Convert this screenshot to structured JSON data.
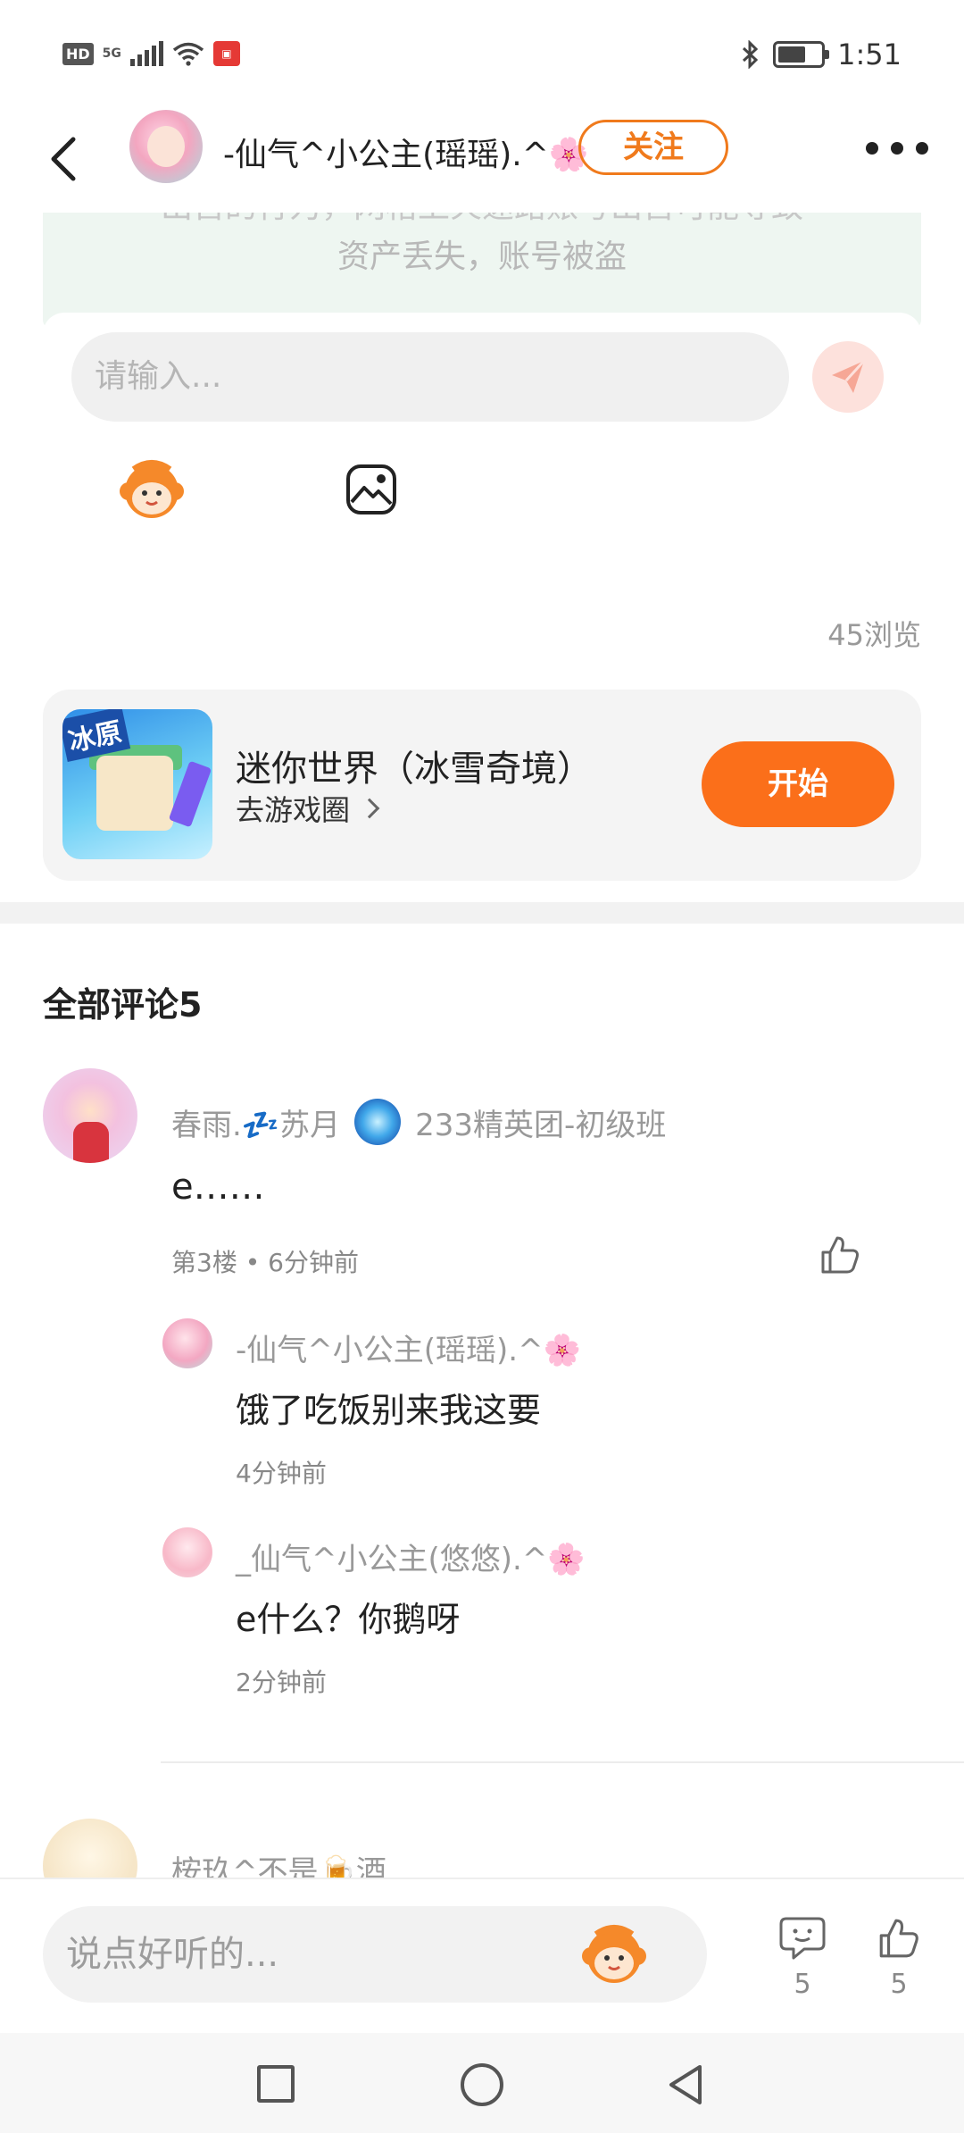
{
  "status_bar": {
    "hd": "HD",
    "network": "5G",
    "time": "1:51",
    "icons": [
      "signal-icon",
      "wifi-icon",
      "app-notification-icon",
      "bluetooth-icon",
      "battery-icon"
    ]
  },
  "header": {
    "username": "-仙气^小公主(瑶瑶).^🌸",
    "follow_label": "关注"
  },
  "notice": {
    "cut_line": "出售的行为，网格上火速路账号出售可能导致",
    "line2": "资产丢失，账号被盗"
  },
  "composer": {
    "placeholder": "请输入..."
  },
  "post": {
    "views": "45浏览"
  },
  "game_card": {
    "icon_tag": "冰原",
    "title": "迷你世界（冰雪奇境）",
    "link_label": "去游戏圈",
    "start_label": "开始"
  },
  "comments": {
    "header": "全部评论5",
    "items": [
      {
        "username": "春雨.💤苏月",
        "badge": "233精英团-初级班",
        "text": "e……",
        "meta": "第3楼 • 6分钟前",
        "replies": [
          {
            "username": "-仙气^小公主(瑶瑶).^🌸",
            "text": "饿了吃饭别来我这要",
            "time": "4分钟前"
          },
          {
            "username": "_仙气^小公主(悠悠).^🌸",
            "text": "e什么？你鹅呀",
            "time": "2分钟前"
          }
        ]
      },
      {
        "username": "桉玖^不是🍺酒"
      }
    ]
  },
  "bottom_bar": {
    "placeholder": "说点好听的...",
    "comment_count": "5",
    "like_count": "5"
  },
  "colors": {
    "accent": "#fb6f1a",
    "follow_border": "#f07a1c",
    "notice_bg": "#eef6f1"
  }
}
